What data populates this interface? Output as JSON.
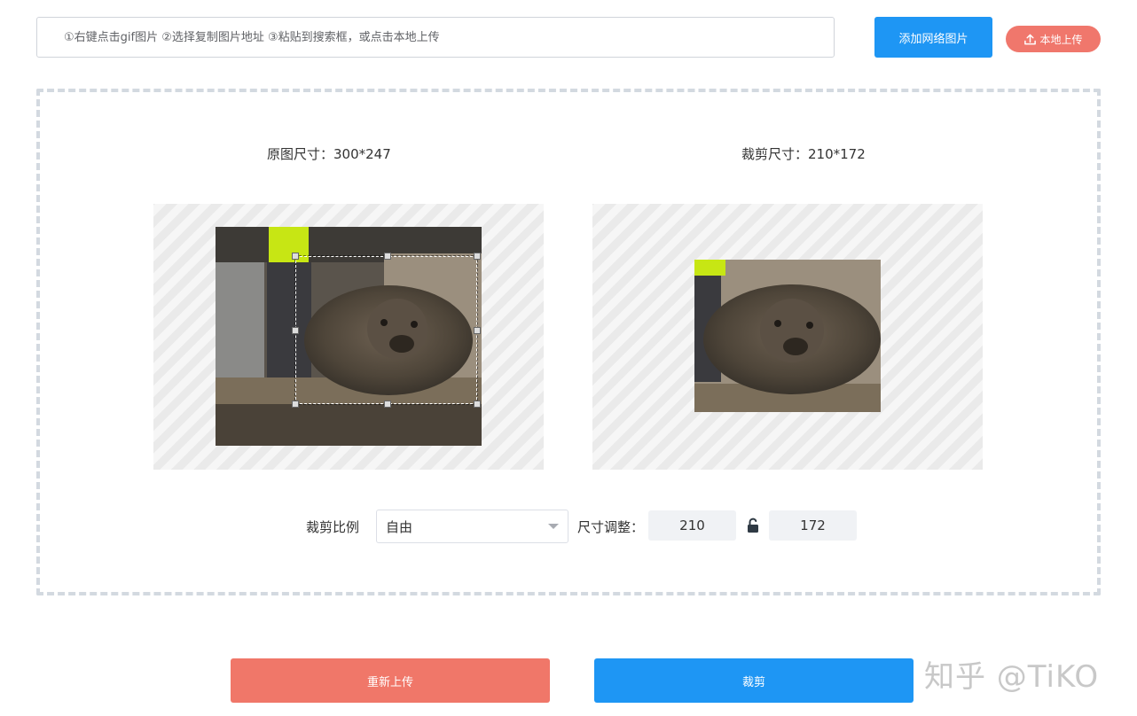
{
  "toolbar": {
    "url_placeholder": "①右键点击gif图片 ②选择复制图片地址 ③粘贴到搜索框，或点击本地上传",
    "add_network_label": "添加网络图片",
    "local_upload_label": "本地上传"
  },
  "preview": {
    "original_size_label": "原图尺寸：300*247",
    "crop_size_label": "裁剪尺寸：210*172"
  },
  "controls": {
    "ratio_label": "裁剪比例",
    "ratio_selected": "自由",
    "size_label": "尺寸调整：",
    "width_value": "210",
    "height_value": "172"
  },
  "actions": {
    "reupload_label": "重新上传",
    "crop_label": "裁剪"
  },
  "watermark": "知乎 @TiKO",
  "colors": {
    "primary": "#1e96f4",
    "danger": "#f07769",
    "input_bg": "#f0f2f5"
  }
}
